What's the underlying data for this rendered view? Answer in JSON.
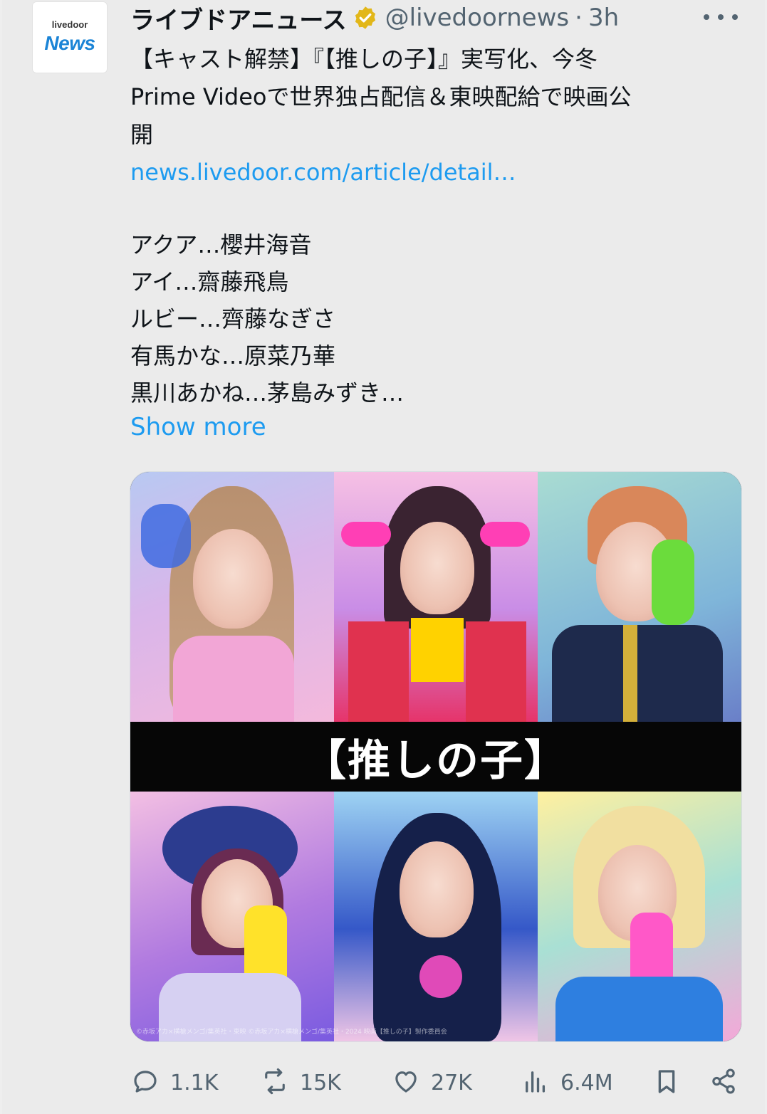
{
  "account": {
    "logo_top": "livedoor",
    "logo_bottom": "News",
    "display_name": "ライブドアニュース",
    "handle": "@livedoornews",
    "separator": "·",
    "time": "3h",
    "verified_color": "#e2b719"
  },
  "tweet": {
    "headline": "【キャスト解禁】『【推しの子】』実写化、今冬Prime Videoで世界独占配信＆東映配給で映画公開",
    "headline_lines": [
      "【キャスト解禁】『【推しの子】』実写化、今冬",
      "Prime Videoで世界独占配信＆東映配給で映画公",
      "開"
    ],
    "link": "news.livedoor.com/article/detail…",
    "cast": [
      "アクア…櫻井海音",
      "アイ…齋藤飛鳥",
      "ルビー…齊藤なぎさ",
      "有馬かな…原菜乃華",
      "黒川あかね…茅島みずき…"
    ],
    "show_more": "Show more"
  },
  "media": {
    "title": "【推しの子】",
    "credit": "©赤坂アカ×横槍メンゴ/集英社・東映 ©赤坂アカ×横槍メンゴ/集英社・2024 映画【推しの子】製作委員会"
  },
  "actions": {
    "replies": "1.1K",
    "reposts": "15K",
    "likes": "27K",
    "views": "6.4M"
  },
  "colors": {
    "link": "#1d9bf0",
    "secondary_text": "#536471",
    "background": "#ebebeb"
  }
}
